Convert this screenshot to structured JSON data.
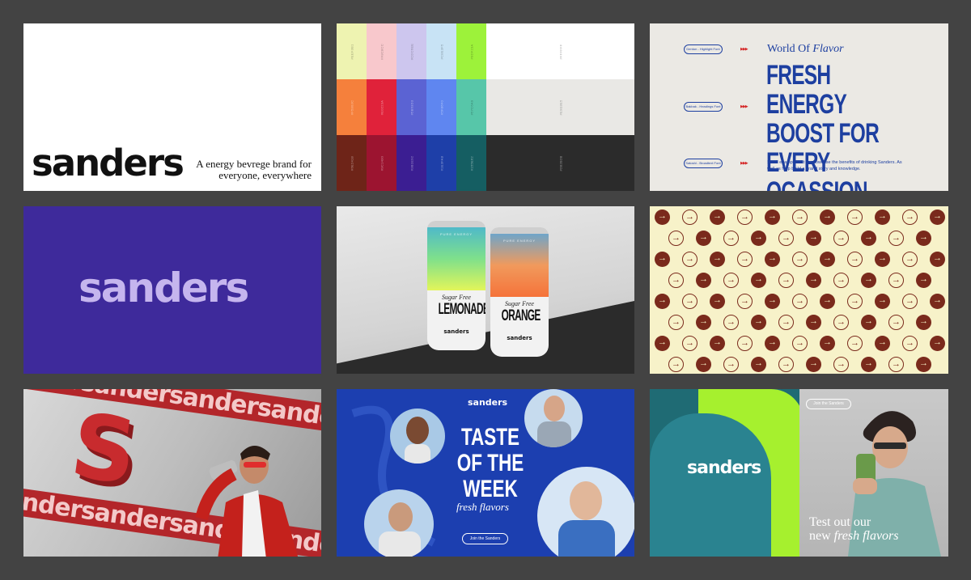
{
  "brand": {
    "name": "sanders",
    "tagline": "A energy bevrege brand for everyone, everywhere"
  },
  "palette": {
    "swatches": [
      {
        "color": "#eef3b1",
        "label": "#EEF3B1"
      },
      {
        "color": "#f8c8cc",
        "label": "#F8C8CC"
      },
      {
        "color": "#cdc6ee",
        "label": "#CDC6EE"
      },
      {
        "color": "#c8e3f5",
        "label": "#C8E3F5"
      },
      {
        "color": "#9df23a",
        "label": "#9DF23A"
      },
      {
        "color": "#ffffff",
        "label": "#FFFFFF"
      },
      {
        "color": "#f5803c",
        "label": "#F5803C"
      },
      {
        "color": "#e0223a",
        "label": "#E0223A"
      },
      {
        "color": "#5b63d3",
        "label": "#5B63D3"
      },
      {
        "color": "#5f86f0",
        "label": "#5F86F0"
      },
      {
        "color": "#57c6a9",
        "label": "#57C6A9"
      },
      {
        "color": "#e9e8e5",
        "label": "#E9E8E5"
      },
      {
        "color": "#6e2418",
        "label": "#6E2418"
      },
      {
        "color": "#9c1430",
        "label": "#9C1430"
      },
      {
        "color": "#3b1e92",
        "label": "#3B1E92"
      },
      {
        "color": "#1e3fa8",
        "label": "#1E3FA8"
      },
      {
        "color": "#155e62",
        "label": "#155E62"
      },
      {
        "color": "#2b2b2b",
        "label": "#2B2B2B"
      }
    ]
  },
  "typography": {
    "fonts": [
      "Denton - Highlight Font",
      "Bakbak - Headings Font",
      "Satoshi - Broadtext Font"
    ],
    "arrows": "▶▶▶",
    "kicker_plain": "World Of",
    "kicker_italic": "Flavor",
    "headline": "FRESH ENERGY BOOST FOR EVERY OCASSION",
    "body": "Small example text to showcase the benefits of drinking Sanders. As well as help build a brand story and knowledge."
  },
  "cans": [
    {
      "sugar": "Sugar Free",
      "flavor": "LEMONADE",
      "brand": "sanders",
      "top": "PURE ENERGY",
      "gradient": [
        "#4fb9c9",
        "#7fe08b",
        "#e3f55a"
      ]
    },
    {
      "sugar": "Sugar Free",
      "flavor": "ORANGE",
      "brand": "sanders",
      "top": "PURE ENERGY",
      "gradient": [
        "#6fa5c9",
        "#f19a5c",
        "#f5733a"
      ]
    }
  ],
  "pattern": {
    "arrow": "→",
    "fill": "#7a2a1c",
    "bg": "#f7f2c9"
  },
  "banner_red": {
    "band_text": "sandersandersandersanders",
    "letter": "S"
  },
  "taste": {
    "brand": "sanders",
    "title": "TASTE OF THE WEEK",
    "subtitle": "fresh flavors",
    "cta": "Join the Sanders"
  },
  "promo": {
    "brand": "sanders",
    "cta": "Join the Sanders",
    "line1": "Test out our",
    "line2_plain": "new",
    "line2_italic": "fresh flavors"
  }
}
